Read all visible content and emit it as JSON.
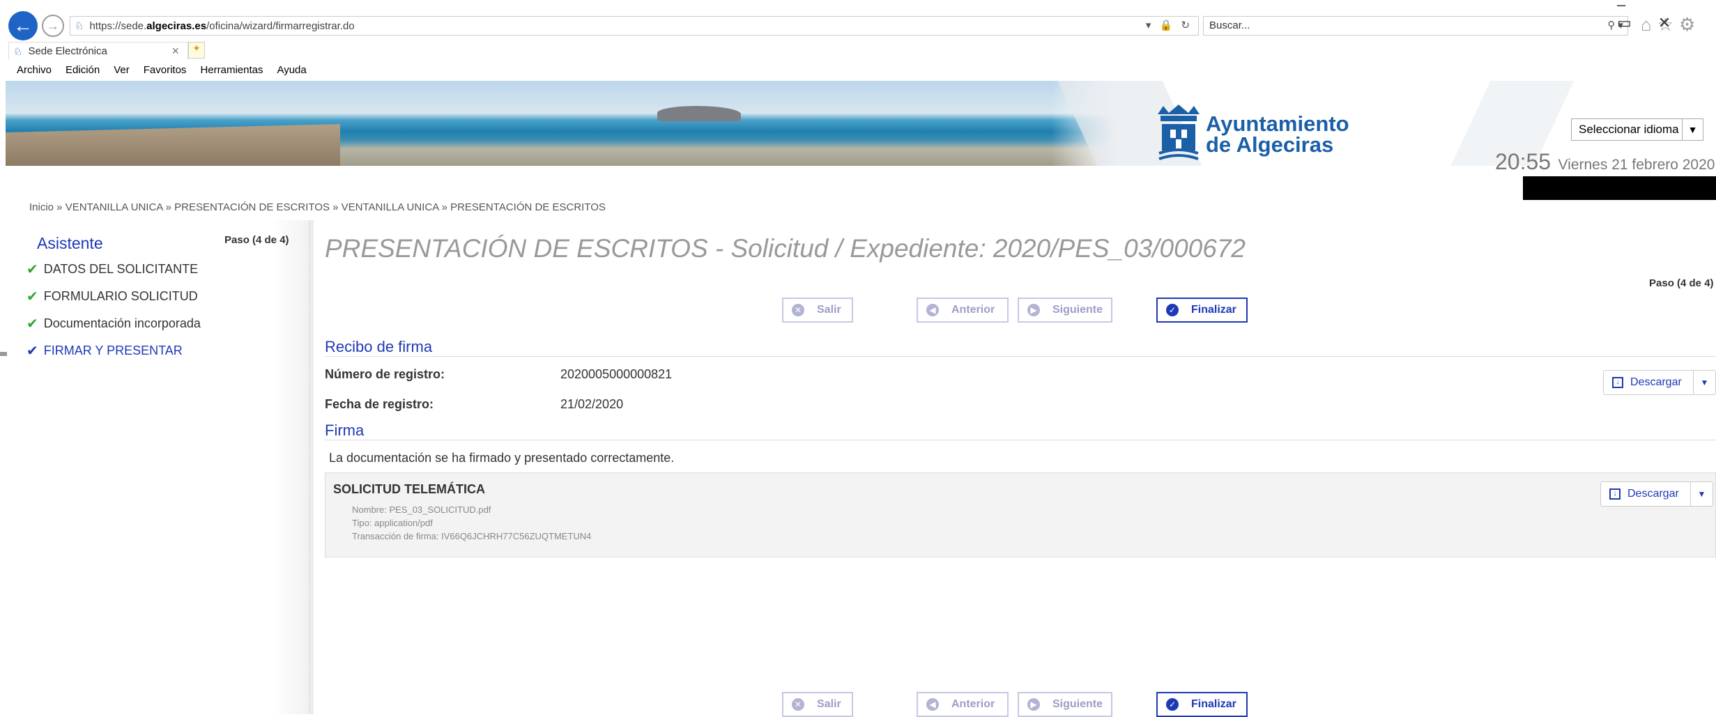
{
  "browser": {
    "url_prefix": "https://sede.",
    "url_host": "algeciras.es",
    "url_path": "/oficina/wizard/firmarregistrar.do",
    "search_placeholder": "Buscar...",
    "tab_title": "Sede Electrónica",
    "menu": [
      "Archivo",
      "Edición",
      "Ver",
      "Favoritos",
      "Herramientas",
      "Ayuda"
    ]
  },
  "header": {
    "logo_line1": "Ayuntamiento",
    "logo_line2": "de Algeciras",
    "language_select": "Seleccionar idioma",
    "time": "20:55",
    "date": "Viernes 21 febrero 2020"
  },
  "breadcrumb": "Inicio » VENTANILLA UNICA » PRESENTACIÓN DE ESCRITOS » VENTANILLA UNICA » PRESENTACIÓN DE ESCRITOS",
  "sidebar": {
    "title": "Asistente",
    "step": "Paso (4 de 4)",
    "items": [
      {
        "label": "DATOS DEL SOLICITANTE"
      },
      {
        "label": "FORMULARIO SOLICITUD"
      },
      {
        "label": "Documentación incorporada"
      },
      {
        "label": "FIRMAR Y PRESENTAR"
      }
    ]
  },
  "main": {
    "title": "PRESENTACIÓN DE ESCRITOS - Solicitud / Expediente: 2020/PES_03/000672",
    "step": "Paso (4 de 4)",
    "buttons": {
      "exit": "Salir",
      "previous": "Anterior",
      "next": "Siguiente",
      "finish": "Finalizar"
    },
    "receipt": {
      "title": "Recibo de firma",
      "registry_number_label": "Número de registro:",
      "registry_number_value": "2020005000000821",
      "registry_date_label": "Fecha de registro:",
      "registry_date_value": "21/02/2020",
      "download": "Descargar"
    },
    "signature": {
      "title": "Firma",
      "message": "La documentación se ha firmado y presentado correctamente.",
      "doc_title": "SOLICITUD TELEMÁTICA",
      "doc_name": "Nombre: PES_03_SOLICITUD.pdf",
      "doc_type": "Tipo: application/pdf",
      "doc_transaction": "Transacción de firma: IV66Q6JCHRH77C56ZUQTMETUN4",
      "download": "Descargar"
    }
  },
  "colors": {
    "accent": "#1f38b6",
    "check": "#2fa52f",
    "logo": "#1b5fa7"
  }
}
